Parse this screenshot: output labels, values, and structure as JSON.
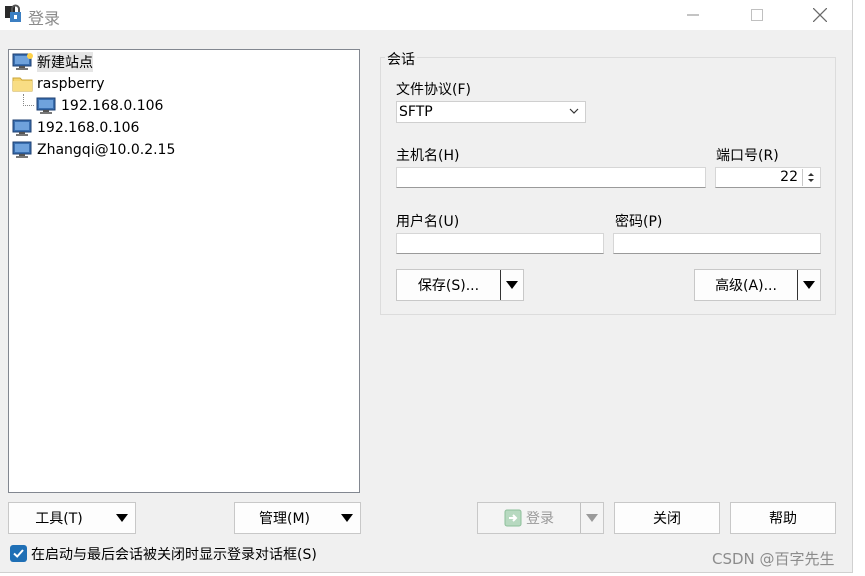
{
  "window": {
    "title": "登录",
    "icons": {
      "app": "winscp-lock-icon",
      "minimize": "minimize-icon",
      "maximize": "maximize-icon",
      "close": "close-icon"
    }
  },
  "tree": {
    "items": [
      {
        "label": "新建站点",
        "icon": "new-site-monitor-icon",
        "selected": true
      },
      {
        "label": "raspberry",
        "icon": "folder-icon"
      },
      {
        "label": "192.168.0.106",
        "icon": "monitor-icon"
      },
      {
        "label": "192.168.0.106",
        "icon": "monitor-icon"
      },
      {
        "label": "Zhangqi@10.0.2.15",
        "icon": "monitor-icon"
      }
    ]
  },
  "session": {
    "legend": "会话",
    "protocol_label": "文件协议(F)",
    "protocol_value": "SFTP",
    "host_label": "主机名(H)",
    "host_value": "",
    "port_label": "端口号(R)",
    "port_value": "22",
    "user_label": "用户名(U)",
    "user_value": "",
    "password_label": "密码(P)",
    "password_value": "",
    "save_label": "保存(S)...",
    "advanced_label": "高级(A)..."
  },
  "bottom": {
    "tools_label": "工具(T)",
    "manage_label": "管理(M)",
    "login_label": "登录",
    "close_label": "关闭",
    "help_label": "帮助",
    "checkbox_label": "在启动与最后会话被关闭时显示登录对话框(S)",
    "checkbox_checked": true
  },
  "watermark": "CSDN @百字先生"
}
